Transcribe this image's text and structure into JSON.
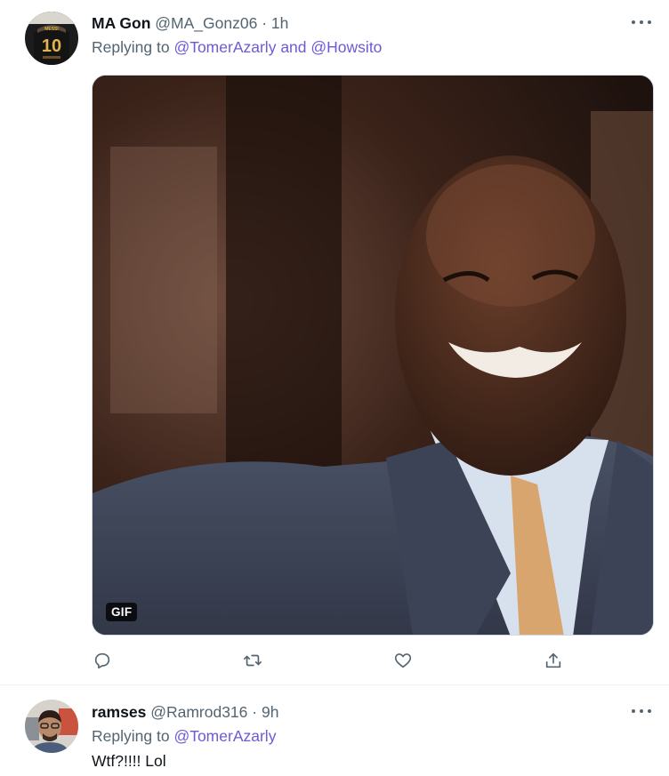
{
  "tweets": [
    {
      "name": "MA Gon",
      "handle": "@MA_Gonz06",
      "separator": "·",
      "time": "1h",
      "replying_prefix": "Replying to",
      "mentions": [
        "@TomerAzarly",
        "@Howsito"
      ],
      "mention_joiner": "and",
      "avatar_jersey_number": "10",
      "media": {
        "type": "gif",
        "badge": "GIF"
      },
      "actions": [
        "reply-icon",
        "retweet-icon",
        "like-icon",
        "share-icon"
      ],
      "more_icon": "more-icon"
    },
    {
      "name": "ramses",
      "handle": "@Ramrod316",
      "separator": "·",
      "time": "9h",
      "replying_prefix": "Replying to",
      "mentions": [
        "@TomerAzarly"
      ],
      "text": "Wtf?!!!! Lol",
      "more_icon": "more-icon"
    }
  ],
  "colors": {
    "accent_mention": "#6b5bd6",
    "secondary_text": "#536471",
    "divider": "#eff3f4"
  }
}
